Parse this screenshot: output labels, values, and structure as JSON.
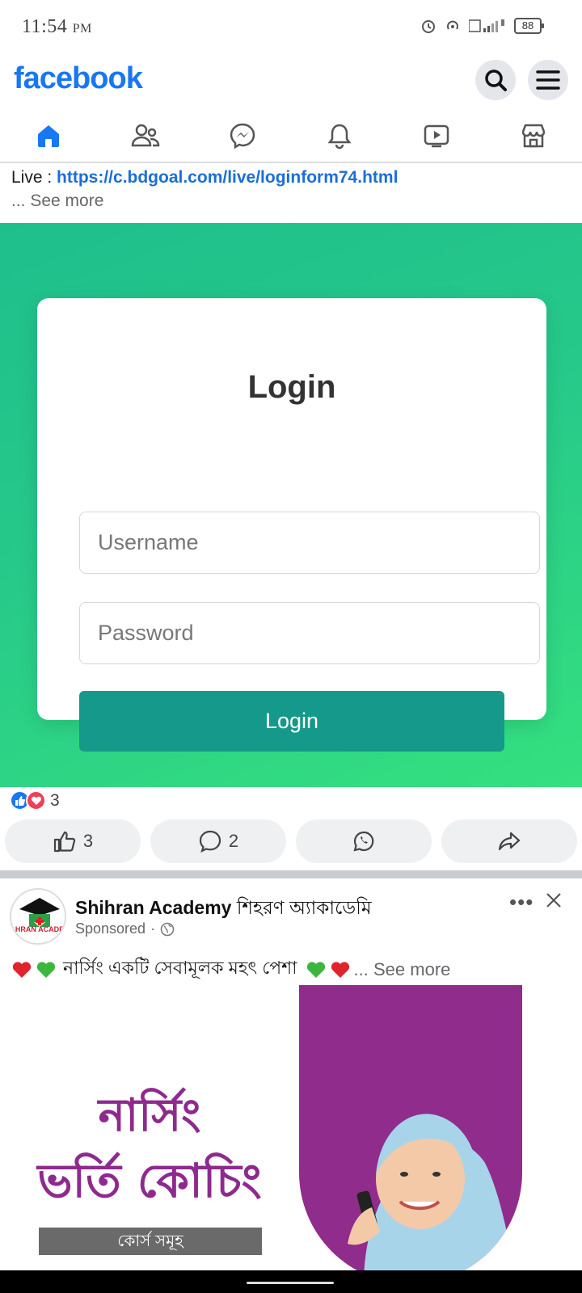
{
  "status_bar": {
    "time": "11:54",
    "ampm": "PM",
    "battery": "88"
  },
  "header": {
    "logo": "facebook"
  },
  "post": {
    "link_prefix": "Live : ",
    "link": "https://c.bdgoal.com/live/loginform74.html",
    "see_more": "... See more"
  },
  "login_form": {
    "title": "Login",
    "username_placeholder": "Username",
    "password_placeholder": "Password",
    "button_label": "Login"
  },
  "engagement": {
    "reaction_count": "3",
    "like_count": "3",
    "comment_count": "2"
  },
  "ad": {
    "page_name": "Shihran Academy",
    "page_name_bn": "শিহরণ অ্যাকাডেমি",
    "sponsored": "Sponsored",
    "text": "নার্সিং একটি সেবামূলক মহৎ পেশা",
    "see_more": "... See more",
    "headline_1": "নার্সিং",
    "headline_2": "ভর্তি কোচিং",
    "bar_label": "কোর্স সমূহ",
    "avatar_text": "HRAN ACADE"
  },
  "colors": {
    "brand": "#1877f2",
    "login_bg": "#27c98a",
    "login_button": "#14998a",
    "ad_purple": "#8f2c8c"
  }
}
